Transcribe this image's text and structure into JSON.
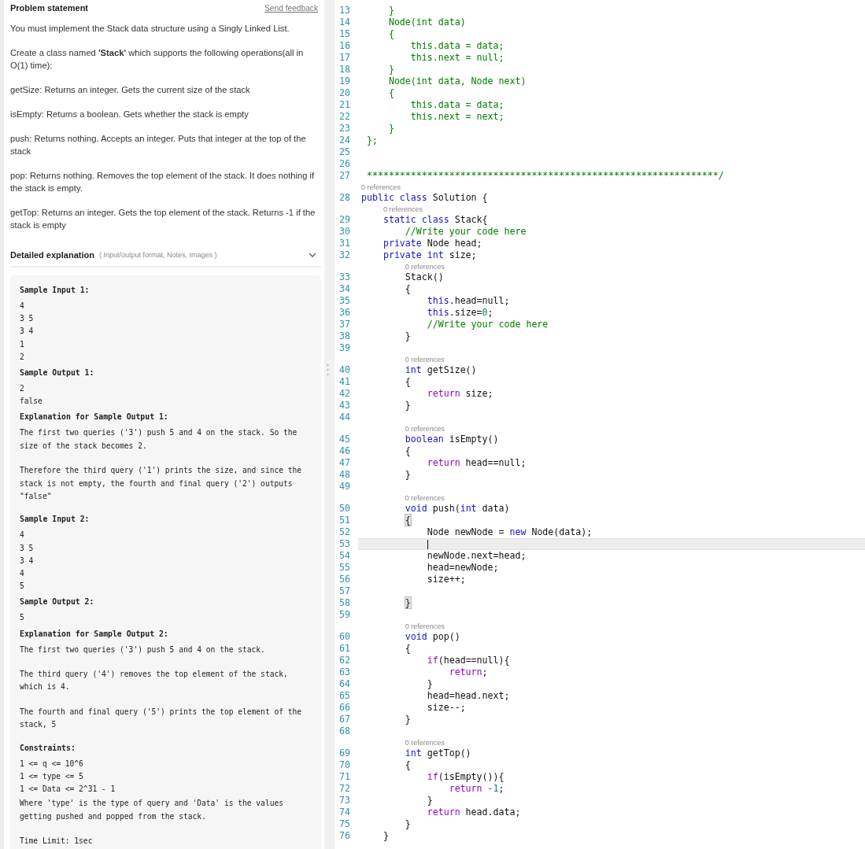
{
  "problem": {
    "title": "Problem statement",
    "feedback_link": "Send feedback",
    "paragraphs": [
      "You must implement the Stack data structure using a Singly Linked List.",
      "Create a class named **'Stack'** which supports the following operations(all in O(1) time):",
      "getSize: Returns an integer. Gets the current size of the stack",
      "isEmpty: Returns a boolean. Gets whether the stack is empty",
      "push: Returns nothing. Accepts an integer. Puts that integer at the top of the stack",
      "pop: Returns nothing. Removes the top element of the stack. It does nothing if the stack is empty.",
      "getTop: Returns an integer. Gets the top element of the stack. Returns -1 if the stack is empty"
    ]
  },
  "details": {
    "title": "Detailed explanation",
    "hint": "( Input/output format, Notes, Images )",
    "expanded": true,
    "blocks": [
      {
        "kind": "heading",
        "text": "Sample Input 1:"
      },
      {
        "kind": "line",
        "text": "4"
      },
      {
        "kind": "line",
        "text": "3 5"
      },
      {
        "kind": "line",
        "text": "3 4"
      },
      {
        "kind": "line",
        "text": "1"
      },
      {
        "kind": "line",
        "text": "2"
      },
      {
        "kind": "heading",
        "text": "Sample Output 1:"
      },
      {
        "kind": "line",
        "text": "2"
      },
      {
        "kind": "line",
        "text": "false"
      },
      {
        "kind": "heading",
        "text": "Explanation for Sample Output 1:"
      },
      {
        "kind": "para",
        "text": "The first two queries ('3') push 5 and 4 on the stack. So the size of the stack becomes 2."
      },
      {
        "kind": "para",
        "text": "Therefore the third query ('1') prints the size, and since the stack is not empty, the fourth and final query ('2') outputs \"false\""
      },
      {
        "kind": "heading",
        "text": "Sample Input 2:"
      },
      {
        "kind": "line",
        "text": "4"
      },
      {
        "kind": "line",
        "text": "3 5"
      },
      {
        "kind": "line",
        "text": "3 4"
      },
      {
        "kind": "line",
        "text": "4"
      },
      {
        "kind": "line",
        "text": "5"
      },
      {
        "kind": "heading",
        "text": "Sample Output 2:"
      },
      {
        "kind": "line",
        "text": "5"
      },
      {
        "kind": "heading",
        "text": "Explanation for Sample Output 2:"
      },
      {
        "kind": "para",
        "text": "The first two queries ('3') push 5 and 4 on the stack."
      },
      {
        "kind": "para",
        "text": "The third query ('4') removes the top element of the stack, which is 4."
      },
      {
        "kind": "para",
        "text": "The fourth and final query ('5') prints the top element of the stack, 5"
      },
      {
        "kind": "heading",
        "text": "Constraints:"
      },
      {
        "kind": "line",
        "text": "1 <= q <= 10^6"
      },
      {
        "kind": "line",
        "text": "1 <= type <= 5"
      },
      {
        "kind": "line",
        "text": "1 <= Data <= 2^31 - 1"
      },
      {
        "kind": "para",
        "text": "Where 'type' is the type of query and 'Data' is the values getting pushed and popped from the stack."
      },
      {
        "kind": "para",
        "text": "Time Limit: 1sec"
      }
    ]
  },
  "editor": {
    "lines": [
      {
        "n": "13",
        "current": false,
        "segs": [
          {
            "kind": "comment",
            "text": "     }"
          }
        ]
      },
      {
        "n": "14",
        "current": false,
        "segs": [
          {
            "kind": "comment",
            "text": "     Node(int data)"
          }
        ]
      },
      {
        "n": "15",
        "current": false,
        "segs": [
          {
            "kind": "comment",
            "text": "     {"
          }
        ]
      },
      {
        "n": "16",
        "current": false,
        "segs": [
          {
            "kind": "comment",
            "text": "         this.data = data;"
          }
        ]
      },
      {
        "n": "17",
        "current": false,
        "segs": [
          {
            "kind": "comment",
            "text": "         this.next = null;"
          }
        ]
      },
      {
        "n": "18",
        "current": false,
        "segs": [
          {
            "kind": "comment",
            "text": "     }"
          }
        ]
      },
      {
        "n": "19",
        "current": false,
        "segs": [
          {
            "kind": "comment",
            "text": "     Node(int data, Node next)"
          }
        ]
      },
      {
        "n": "20",
        "current": false,
        "segs": [
          {
            "kind": "comment",
            "text": "     {"
          }
        ]
      },
      {
        "n": "21",
        "current": false,
        "segs": [
          {
            "kind": "comment",
            "text": "         this.data = data;"
          }
        ]
      },
      {
        "n": "22",
        "current": false,
        "segs": [
          {
            "kind": "comment",
            "text": "         this.next = next;"
          }
        ]
      },
      {
        "n": "23",
        "current": false,
        "segs": [
          {
            "kind": "comment",
            "text": "     }"
          }
        ]
      },
      {
        "n": "24",
        "current": false,
        "segs": [
          {
            "kind": "comment",
            "text": " };"
          }
        ]
      },
      {
        "n": "25",
        "current": false
      },
      {
        "n": "26",
        "current": false
      },
      {
        "n": "27",
        "current": false,
        "segs": [
          {
            "kind": "comment",
            "text": " ****************************************************************/"
          }
        ]
      },
      {
        "n": "28",
        "current": false,
        "refs": "0 references",
        "segs": [
          {
            "kind": "keyword",
            "text": "public class"
          },
          {
            "kind": "plain",
            "text": " Solution {"
          }
        ]
      },
      {
        "n": "29",
        "current": false,
        "refs": "0 references",
        "segs": [
          {
            "kind": "keyword",
            "text": "    static class"
          },
          {
            "kind": "plain",
            "text": " Stack{"
          }
        ]
      },
      {
        "n": "30",
        "current": false,
        "segs": [
          {
            "kind": "comment",
            "text": "        //Write your code here"
          }
        ]
      },
      {
        "n": "31",
        "current": false,
        "segs": [
          {
            "kind": "keyword",
            "text": "    private"
          },
          {
            "kind": "plain",
            "text": " Node head;"
          }
        ]
      },
      {
        "n": "32",
        "current": false,
        "segs": [
          {
            "kind": "keyword",
            "text": "    private int"
          },
          {
            "kind": "plain",
            "text": " size;"
          }
        ]
      },
      {
        "n": "33",
        "current": false,
        "refs": "0 references",
        "segs": [
          {
            "kind": "plain",
            "text": "        Stack()"
          }
        ]
      },
      {
        "n": "34",
        "current": false,
        "segs": [
          {
            "kind": "plain",
            "text": "        {"
          }
        ]
      },
      {
        "n": "35",
        "current": false,
        "segs": [
          {
            "kind": "keyword",
            "text": "            this"
          },
          {
            "kind": "plain",
            "text": ".head=null;"
          }
        ]
      },
      {
        "n": "36",
        "current": false,
        "segs": [
          {
            "kind": "keyword",
            "text": "            this"
          },
          {
            "kind": "plain",
            "text": ".size="
          },
          {
            "kind": "number",
            "text": "0"
          },
          {
            "kind": "plain",
            "text": ";"
          }
        ]
      },
      {
        "n": "37",
        "current": false,
        "segs": [
          {
            "kind": "comment",
            "text": "            //Write your code here"
          }
        ]
      },
      {
        "n": "38",
        "current": false,
        "segs": [
          {
            "kind": "plain",
            "text": "        }"
          }
        ]
      },
      {
        "n": "39",
        "current": false
      },
      {
        "n": "40",
        "current": false,
        "refs": "0 references",
        "segs": [
          {
            "kind": "keyword",
            "text": "        int"
          },
          {
            "kind": "plain",
            "text": " getSize()"
          }
        ]
      },
      {
        "n": "41",
        "current": false,
        "segs": [
          {
            "kind": "plain",
            "text": "        {"
          }
        ]
      },
      {
        "n": "42",
        "current": false,
        "segs": [
          {
            "kind": "control",
            "text": "            return"
          },
          {
            "kind": "plain",
            "text": " size;"
          }
        ]
      },
      {
        "n": "43",
        "current": false,
        "segs": [
          {
            "kind": "plain",
            "text": "        }"
          }
        ]
      },
      {
        "n": "44",
        "current": false
      },
      {
        "n": "45",
        "current": false,
        "refs": "0 references",
        "segs": [
          {
            "kind": "keyword",
            "text": "        boolean"
          },
          {
            "kind": "plain",
            "text": " isEmpty()"
          }
        ]
      },
      {
        "n": "46",
        "current": false,
        "segs": [
          {
            "kind": "plain",
            "text": "        {"
          }
        ]
      },
      {
        "n": "47",
        "current": false,
        "segs": [
          {
            "kind": "control",
            "text": "            return"
          },
          {
            "kind": "plain",
            "text": " head==null;"
          }
        ]
      },
      {
        "n": "48",
        "current": false,
        "segs": [
          {
            "kind": "plain",
            "text": "        }"
          }
        ]
      },
      {
        "n": "49",
        "current": false
      },
      {
        "n": "50",
        "current": false,
        "refs": "0 references",
        "segs": [
          {
            "kind": "keyword",
            "text": "        void"
          },
          {
            "kind": "plain",
            "text": " push("
          },
          {
            "kind": "keyword",
            "text": "int"
          },
          {
            "kind": "plain",
            "text": " data)"
          }
        ]
      },
      {
        "n": "51",
        "current": false,
        "segs": [
          {
            "kind": "matched",
            "text": "        {"
          }
        ]
      },
      {
        "n": "52",
        "current": false,
        "segs": [
          {
            "kind": "plain",
            "text": "            Node newNode = "
          },
          {
            "kind": "keyword",
            "text": "new"
          },
          {
            "kind": "plain",
            "text": " Node(data);"
          }
        ]
      },
      {
        "n": "53",
        "current": true
      },
      {
        "n": "54",
        "current": false,
        "segs": [
          {
            "kind": "plain",
            "text": "            newNode.next=head;"
          }
        ]
      },
      {
        "n": "55",
        "current": false,
        "segs": [
          {
            "kind": "plain",
            "text": "            head=newNode;"
          }
        ]
      },
      {
        "n": "56",
        "current": false,
        "segs": [
          {
            "kind": "plain",
            "text": "            size++;"
          }
        ]
      },
      {
        "n": "57",
        "current": false
      },
      {
        "n": "58",
        "current": false,
        "segs": [
          {
            "kind": "matched",
            "text": "        }"
          }
        ]
      },
      {
        "n": "59",
        "current": false
      },
      {
        "n": "60",
        "current": false,
        "refs": "0 references",
        "segs": [
          {
            "kind": "keyword",
            "text": "        void"
          },
          {
            "kind": "plain",
            "text": " pop()"
          }
        ]
      },
      {
        "n": "61",
        "current": false,
        "segs": [
          {
            "kind": "plain",
            "text": "        {"
          }
        ]
      },
      {
        "n": "62",
        "current": false,
        "segs": [
          {
            "kind": "control",
            "text": "            if"
          },
          {
            "kind": "plain",
            "text": "(head==null){"
          }
        ]
      },
      {
        "n": "63",
        "current": false,
        "segs": [
          {
            "kind": "control",
            "text": "                return"
          },
          {
            "kind": "plain",
            "text": ";"
          }
        ]
      },
      {
        "n": "64",
        "current": false,
        "segs": [
          {
            "kind": "plain",
            "text": "            }"
          }
        ]
      },
      {
        "n": "65",
        "current": false,
        "segs": [
          {
            "kind": "plain",
            "text": "            head=head.next;"
          }
        ]
      },
      {
        "n": "66",
        "current": false,
        "segs": [
          {
            "kind": "plain",
            "text": "            size--;"
          }
        ]
      },
      {
        "n": "67",
        "current": false,
        "segs": [
          {
            "kind": "plain",
            "text": "        }"
          }
        ]
      },
      {
        "n": "68",
        "current": false
      },
      {
        "n": "69",
        "current": false,
        "refs": "0 references",
        "segs": [
          {
            "kind": "keyword",
            "text": "        int"
          },
          {
            "kind": "plain",
            "text": " getTop()"
          }
        ]
      },
      {
        "n": "70",
        "current": false,
        "segs": [
          {
            "kind": "plain",
            "text": "        {"
          }
        ]
      },
      {
        "n": "71",
        "current": false,
        "segs": [
          {
            "kind": "control",
            "text": "            if"
          },
          {
            "kind": "plain",
            "text": "(isEmpty()){"
          }
        ]
      },
      {
        "n": "72",
        "current": false,
        "segs": [
          {
            "kind": "control",
            "text": "                return"
          },
          {
            "kind": "number",
            "text": " -1"
          },
          {
            "kind": "plain",
            "text": ";"
          }
        ]
      },
      {
        "n": "73",
        "current": false,
        "segs": [
          {
            "kind": "plain",
            "text": "            }"
          }
        ]
      },
      {
        "n": "74",
        "current": false,
        "segs": [
          {
            "kind": "control",
            "text": "            return"
          },
          {
            "kind": "plain",
            "text": " head.data;"
          }
        ]
      },
      {
        "n": "75",
        "current": false,
        "segs": [
          {
            "kind": "plain",
            "text": "        }"
          }
        ]
      },
      {
        "n": "76",
        "current": false,
        "segs": [
          {
            "kind": "plain",
            "text": "    }"
          }
        ]
      }
    ]
  }
}
